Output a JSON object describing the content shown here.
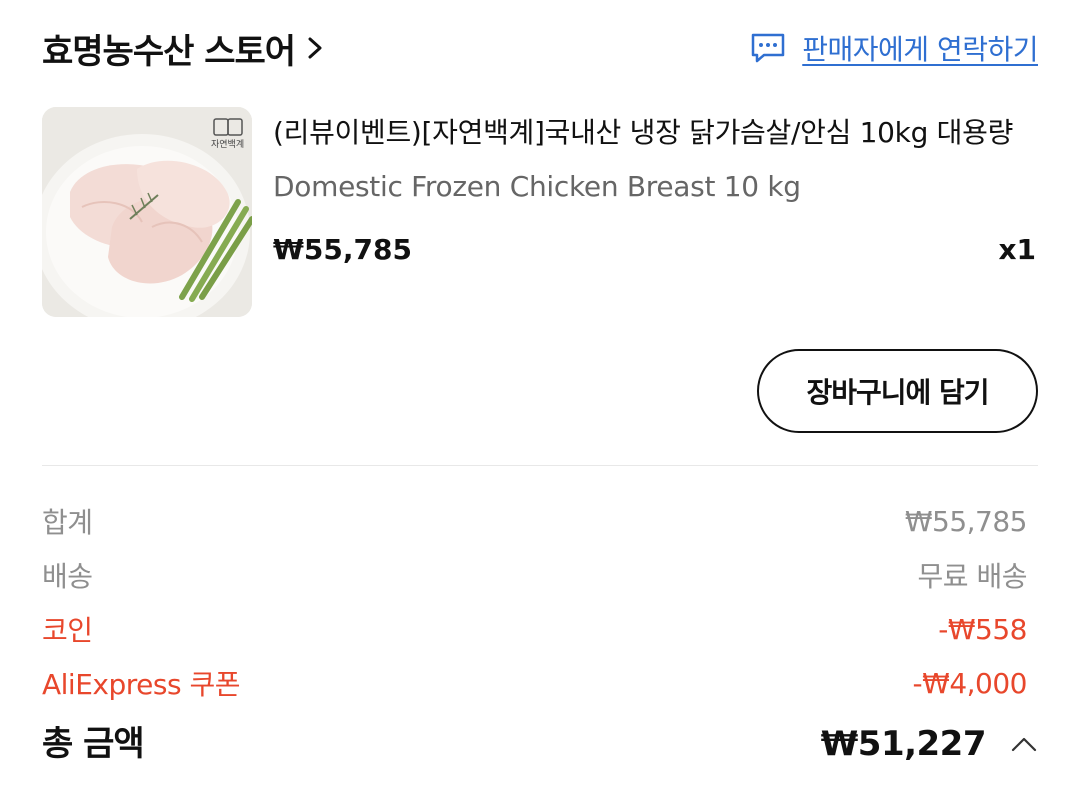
{
  "store": {
    "name": "효명농수산 스토어",
    "contact_label": "판매자에게 연락하기"
  },
  "product": {
    "image_badge": "자연백계",
    "title": "(리뷰이벤트)[자연백계]국내산 냉장 닭가슴살/안심 10kg 대용량",
    "subtitle": "Domestic Frozen Chicken Breast 10 kg",
    "price": "₩55,785",
    "quantity": "x1"
  },
  "actions": {
    "add_to_cart": "장바구니에 담기"
  },
  "summary": {
    "rows": [
      {
        "label": "합계",
        "value": "₩55,785"
      },
      {
        "label": "배송",
        "value": "무료 배송"
      },
      {
        "label": "코인",
        "value": "-₩558"
      },
      {
        "label": "AliExpress 쿠폰",
        "value": "-₩4,000"
      }
    ],
    "total_label": "총 금액",
    "total_value": "₩51,227"
  },
  "colors": {
    "link_blue": "#2f6fd1",
    "discount_red": "#e8472c",
    "muted_gray": "#8f8f8f"
  }
}
